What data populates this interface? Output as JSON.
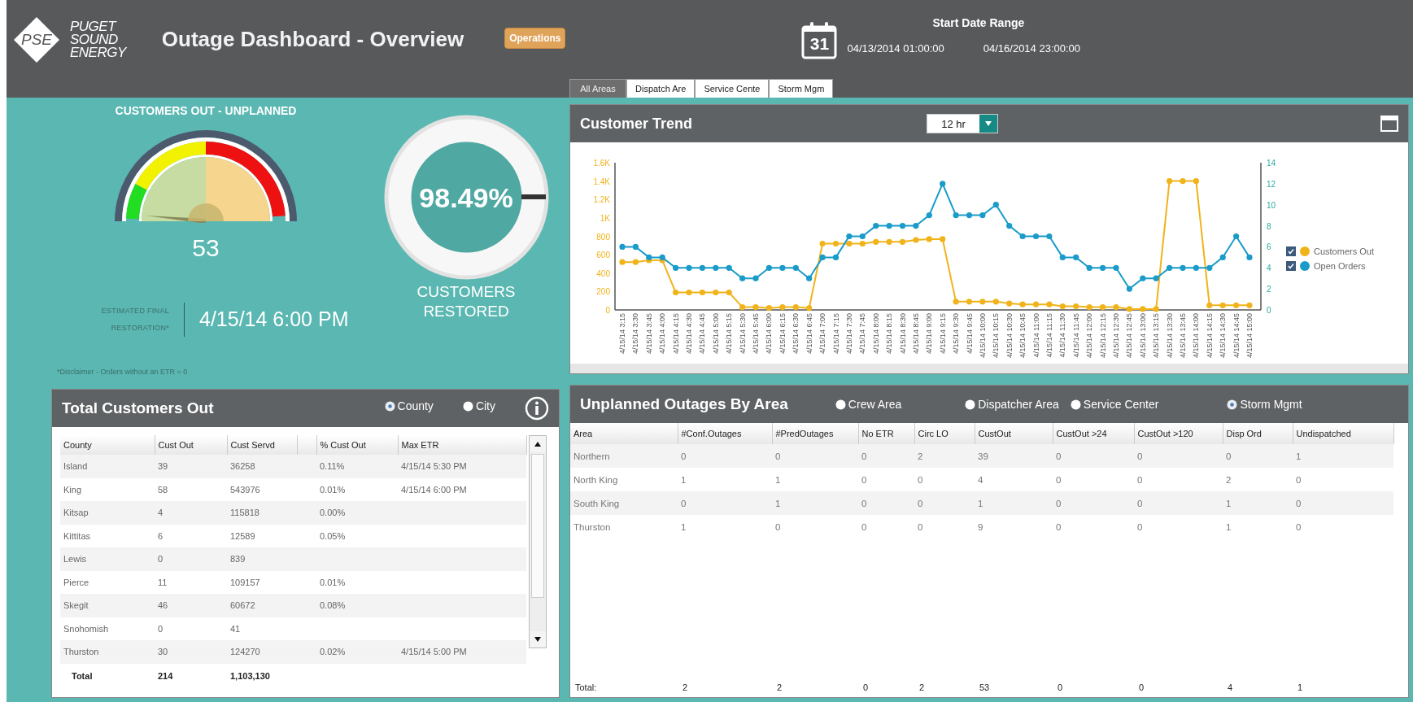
{
  "header": {
    "logo_text": "PSE",
    "brand": "PUGET SOUND ENERGY",
    "title": "Outage Dashboard - Overview",
    "badge": "Operations",
    "calendar_day": "31",
    "date_range_label": "Start Date Range",
    "start": "04/13/2014 01:00:00",
    "end": "04/16/2014 23:00:00"
  },
  "tabs": [
    {
      "label": "All Areas",
      "selected": true
    },
    {
      "label": "Dispatch Are",
      "selected": false
    },
    {
      "label": "Service Cente",
      "selected": false
    },
    {
      "label": "Storm Mgm",
      "selected": false
    }
  ],
  "gauge": {
    "title": "CUSTOMERS OUT - UNPLANNED",
    "level": 0.03,
    "value": "53"
  },
  "restored": {
    "percent": "98.49%",
    "label": "CUSTOMERS RESTORED"
  },
  "etr": {
    "label": "ESTIMATED FINAL RESTORATION*",
    "value": "4/15/14 6:00 PM",
    "disclaimer": "*Disclaimer - Orders without an ETR = 0"
  },
  "customers_table": {
    "title": "Total Customers Out",
    "options": [
      {
        "label": "County",
        "selected": true
      },
      {
        "label": "City",
        "selected": false
      }
    ],
    "columns": [
      "County",
      "Cust Out",
      "Cust Servd",
      "% Cust Out",
      "Max ETR"
    ],
    "rows": [
      [
        "Island",
        "39",
        "36258",
        "0.11%",
        "4/15/14 5:30 PM"
      ],
      [
        "King",
        "58",
        "543976",
        "0.01%",
        "4/15/14 6:00 PM"
      ],
      [
        "Kitsap",
        "4",
        "115818",
        "0.00%",
        null
      ],
      [
        "Kittitas",
        "6",
        "12589",
        "0.05%",
        null
      ],
      [
        "Lewis",
        "0",
        "839",
        null,
        null
      ],
      [
        "Pierce",
        "11",
        "109157",
        "0.01%",
        null
      ],
      [
        "Skegit",
        "46",
        "60672",
        "0.08%",
        null
      ],
      [
        "Snohomish",
        "0",
        "41",
        null,
        null
      ],
      [
        "Thurston",
        "30",
        "124270",
        "0.02%",
        "4/15/14 5:00 PM"
      ]
    ],
    "total": [
      "Total",
      "214",
      "1,103,130"
    ]
  },
  "trend": {
    "title": "Customer Trend",
    "range": "12 hr",
    "legend_checkboxes": [
      {
        "checked": true
      },
      {
        "checked": true
      }
    ],
    "chart_data": {
      "type": "line",
      "legend": "right",
      "x": [
        "4/15/14 3:15",
        "4/15/14 3:30",
        "4/15/14 3:45",
        "4/15/14 4:00",
        "4/15/14 4:15",
        "4/15/14 4:30",
        "4/15/14 4:45",
        "4/15/14 5:00",
        "4/15/14 5:15",
        "4/15/14 5:30",
        "4/15/14 5:45",
        "4/15/14 6:00",
        "4/15/14 6:15",
        "4/15/14 6:30",
        "4/15/14 6:45",
        "4/15/14 7:00",
        "4/15/14 7:15",
        "4/15/14 7:30",
        "4/15/14 7:45",
        "4/15/14 8:00",
        "4/15/14 8:15",
        "4/15/14 8:30",
        "4/15/14 8:45",
        "4/15/14 9:00",
        "4/15/14 9:15",
        "4/15/14 9:30",
        "4/15/14 9:45",
        "4/15/14 10:00",
        "4/15/14 10:15",
        "4/15/14 10:30",
        "4/15/14 10:45",
        "4/15/14 11:00",
        "4/15/14 11:15",
        "4/15/14 11:30",
        "4/15/14 11:45",
        "4/15/14 12:00",
        "4/15/14 12:15",
        "4/15/14 12:30",
        "4/15/14 12:45",
        "4/15/14 13:00",
        "4/15/14 13:15",
        "4/15/14 13:30",
        "4/15/14 13:45",
        "4/15/14 14:00",
        "4/15/14 14:15",
        "4/15/14 14:30",
        "4/15/14 14:45",
        "4/15/14 15:00"
      ],
      "ylim": [
        0,
        1600
      ],
      "yticks": [
        0,
        200,
        400,
        600,
        800,
        {
          "value": 1000,
          "label": "1K"
        },
        {
          "value": 1200,
          "label": "1.2K"
        },
        {
          "value": 1400,
          "label": "1.4K"
        },
        {
          "value": 1600,
          "label": "1.6K"
        }
      ],
      "y2lim": [
        0,
        14
      ],
      "y2ticks": [
        0,
        2,
        4,
        6,
        8,
        10,
        12,
        14
      ],
      "series": [
        {
          "name": "Customers Out",
          "color": "#f0b31a",
          "marker": "circle",
          "values": [
            520,
            520,
            540,
            540,
            190,
            190,
            190,
            190,
            190,
            30,
            30,
            20,
            30,
            30,
            20,
            720,
            720,
            720,
            720,
            740,
            740,
            740,
            760,
            770,
            770,
            90,
            90,
            90,
            90,
            70,
            60,
            60,
            60,
            40,
            40,
            30,
            30,
            30,
            10,
            10,
            10,
            1400,
            1400,
            1400,
            50,
            50,
            50,
            50
          ]
        },
        {
          "name": "Open Orders",
          "color": "#1a9bc9",
          "axis": "y2",
          "marker": "circle",
          "values": [
            6,
            6,
            5,
            5,
            4,
            4,
            4,
            4,
            4,
            3,
            3,
            4,
            4,
            4,
            3,
            5,
            5,
            7,
            7,
            8,
            8,
            8,
            8,
            9,
            12,
            9,
            9,
            9,
            10,
            8,
            7,
            7,
            7,
            5,
            5,
            4,
            4,
            4,
            2,
            3,
            3,
            4,
            4,
            4,
            4,
            5,
            7,
            5
          ]
        }
      ]
    }
  },
  "area_table": {
    "title": "Unplanned Outages By Area",
    "options": [
      {
        "label": "Crew Area",
        "selected": false
      },
      {
        "label": "Dispatcher Area",
        "selected": false
      },
      {
        "label": "Service Center",
        "selected": false
      },
      {
        "label": "Storm Mgmt",
        "selected": true
      }
    ],
    "columns": [
      "Area",
      "#Conf.Outages",
      "#PredOutages",
      "No ETR",
      "Circ LO",
      "CustOut",
      "CustOut >24",
      "CustOut >120",
      "Disp Ord",
      "Undispatched"
    ],
    "rows": [
      [
        "Northern",
        "0",
        "0",
        "0",
        "2",
        "39",
        "0",
        "0",
        "0",
        "1"
      ],
      [
        "North King",
        "1",
        "1",
        "0",
        "0",
        "4",
        "0",
        "0",
        "2",
        "0"
      ],
      [
        "South King",
        "0",
        "1",
        "0",
        "0",
        "1",
        "0",
        "0",
        "1",
        "0"
      ],
      [
        "Thurston",
        "1",
        "0",
        "0",
        "0",
        "9",
        "0",
        "0",
        "1",
        "0"
      ]
    ],
    "total": [
      "Total:",
      "2",
      "2",
      "0",
      "2",
      "53",
      "0",
      "0",
      "4",
      "1"
    ]
  }
}
